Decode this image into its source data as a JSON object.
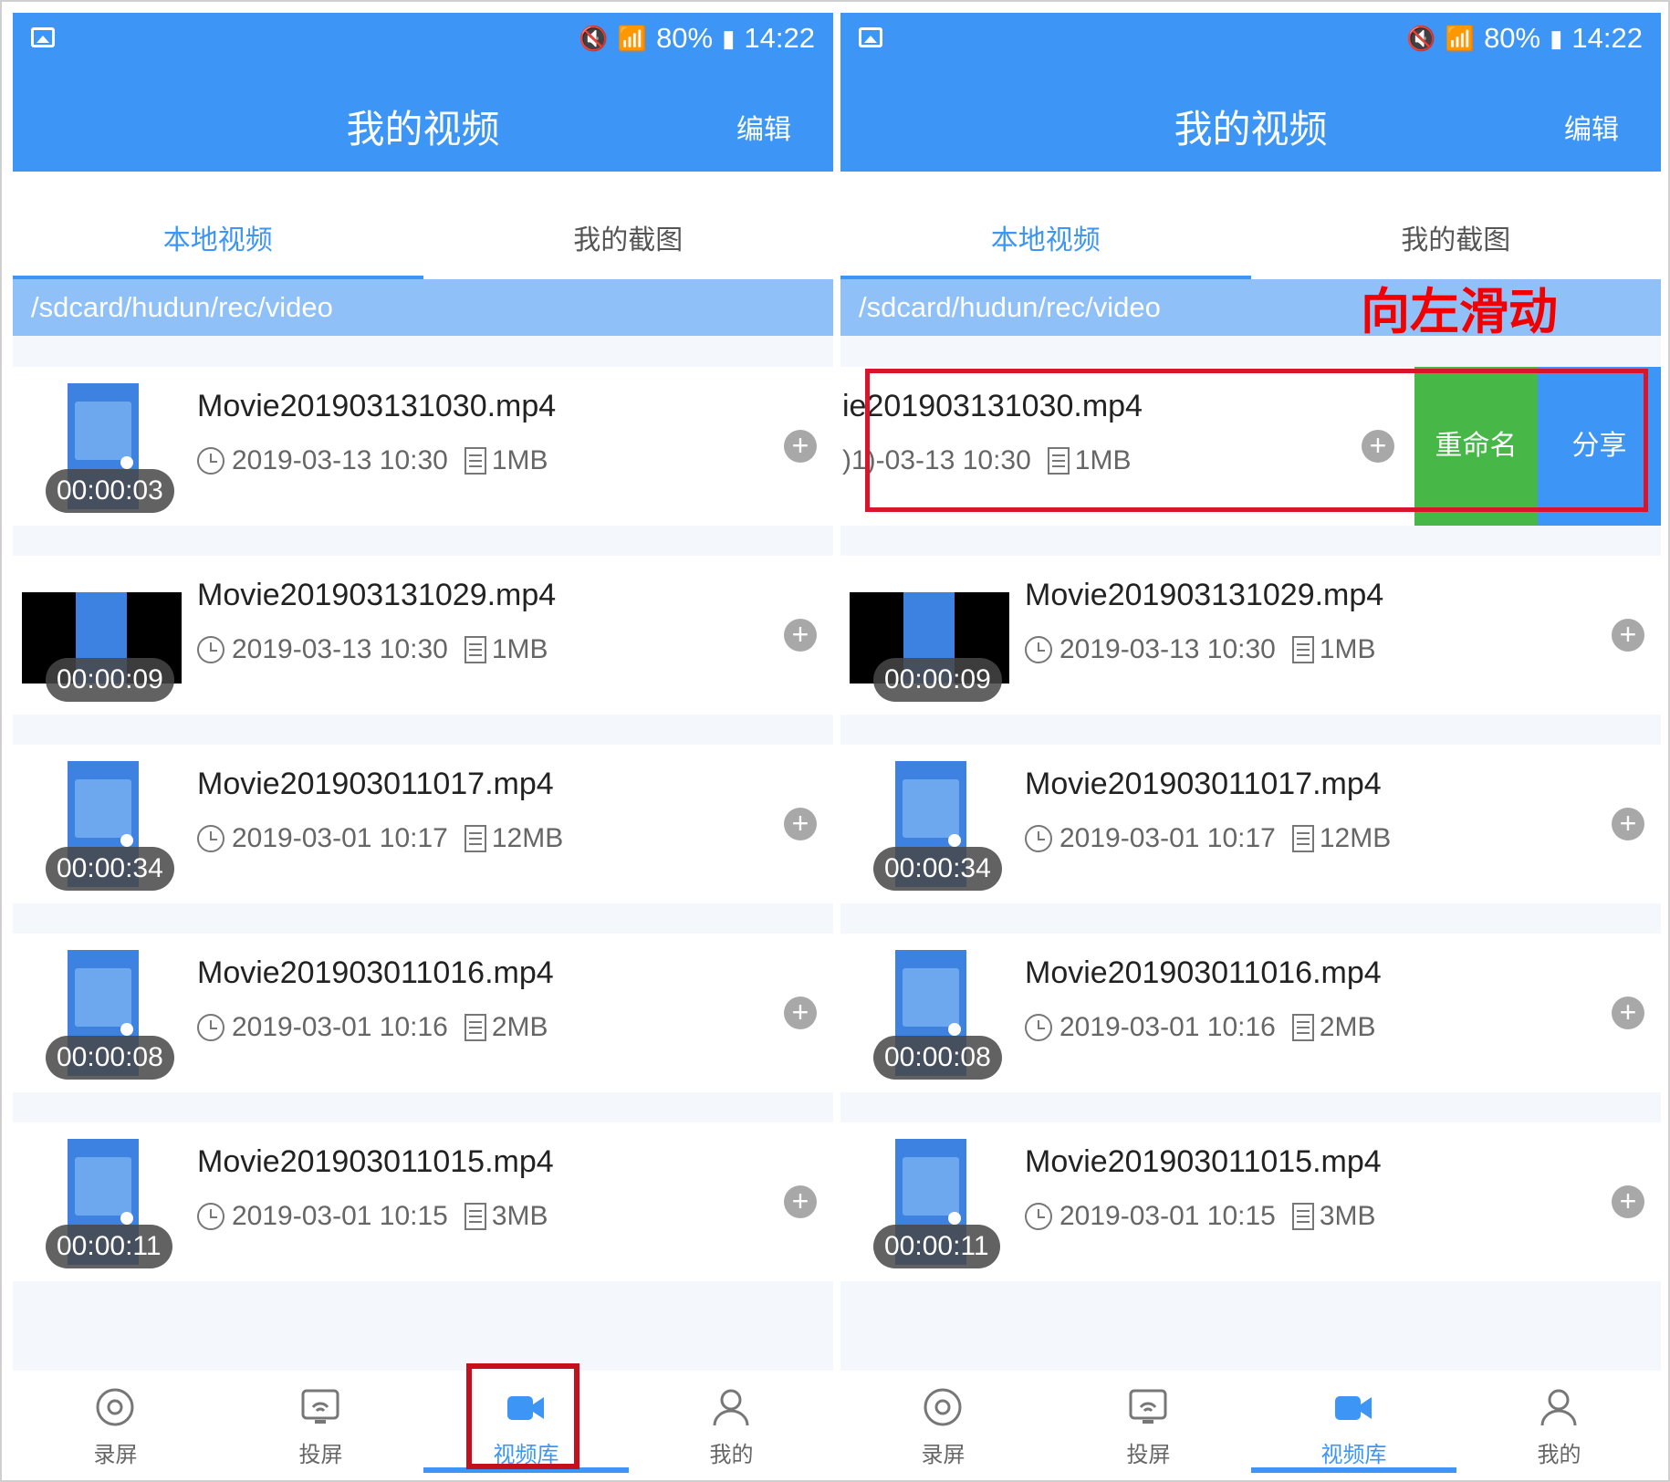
{
  "status": {
    "battery": "80%",
    "time": "14:22",
    "network": "4G"
  },
  "appbar": {
    "title": "我的视频",
    "edit": "编辑"
  },
  "tabs": {
    "local": "本地视频",
    "screenshots": "我的截图"
  },
  "path": "/sdcard/hudun/rec/video",
  "annotation": {
    "swipe_hint": "向左滑动"
  },
  "actions": {
    "rename": "重命名",
    "share": "分享"
  },
  "swiped_row": {
    "name": "ie201903131030.mp4",
    "date": ")1)-03-13 10:30",
    "size": "1MB"
  },
  "videos": [
    {
      "name": "Movie201903131030.mp4",
      "date": "2019-03-13 10:30",
      "size": "1MB",
      "duration": "00:00:03"
    },
    {
      "name": "Movie201903131029.mp4",
      "date": "2019-03-13 10:30",
      "size": "1MB",
      "duration": "00:00:09"
    },
    {
      "name": "Movie201903011017.mp4",
      "date": "2019-03-01 10:17",
      "size": "12MB",
      "duration": "00:00:34"
    },
    {
      "name": "Movie201903011016.mp4",
      "date": "2019-03-01 10:16",
      "size": "2MB",
      "duration": "00:00:08"
    },
    {
      "name": "Movie201903011015.mp4",
      "date": "2019-03-01 10:15",
      "size": "3MB",
      "duration": "00:00:11"
    }
  ],
  "nav": {
    "record": "录屏",
    "cast": "投屏",
    "library": "视频库",
    "mine": "我的"
  },
  "icons": {
    "record": "record-icon",
    "cast": "cast-icon",
    "library": "video-camera-icon",
    "mine": "person-icon",
    "clock": "clock-icon",
    "file": "file-icon",
    "plus": "plus-icon"
  },
  "colors": {
    "primary": "#3d96f5",
    "rename": "#47b748",
    "annotation_red": "#d9142d"
  }
}
